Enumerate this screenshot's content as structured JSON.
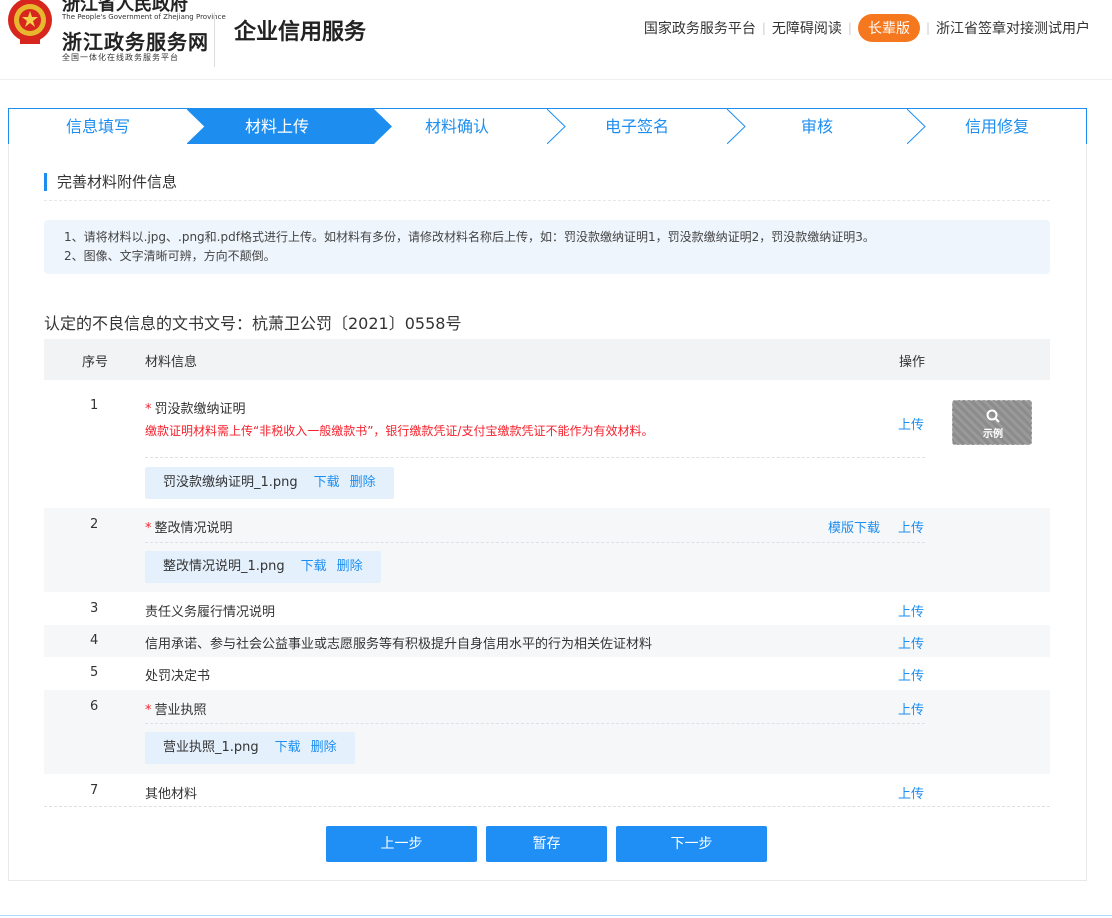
{
  "header": {
    "gov_name": "浙江省人民政府",
    "gov_name_en": "The People's Government of Zhejiang Province",
    "portal_name": "浙江政务服务网",
    "portal_sub": "全国一体化在线政务服务平台",
    "service_title": "企业信用服务",
    "links": {
      "national_platform": "国家政务服务平台",
      "accessibility": "无障碍阅读",
      "elder_mode": "长辈版",
      "user": "浙江省签章对接测试用户"
    }
  },
  "steps": [
    {
      "label": "信息填写",
      "active": false
    },
    {
      "label": "材料上传",
      "active": true
    },
    {
      "label": "材料确认",
      "active": false
    },
    {
      "label": "电子签名",
      "active": false
    },
    {
      "label": "审核",
      "active": false
    },
    {
      "label": "信用修复",
      "active": false
    }
  ],
  "section": {
    "title": "完善材料附件信息",
    "notice_1": "1、请将材料以.jpg、.png和.pdf格式进行上传。如材料有多份，请修改材料名称后上传，如：罚没款缴纳证明1，罚没款缴纳证明2，罚没款缴纳证明3。",
    "notice_2": "2、图像、文字清晰可辨，方向不颠倒。"
  },
  "doc_number": "认定的不良信息的文书文号：杭萧卫公罚〔2021〕0558号",
  "table": {
    "headers": {
      "no": "序号",
      "info": "材料信息",
      "op": "操作"
    },
    "rows": [
      {
        "no": "1",
        "name": "罚没款缴纳证明",
        "warning": "缴款证明材料需上传“非税收入一般缴款书”，银行缴款凭证/支付宝缴款凭证不能作为有效材料。",
        "upload": "上传",
        "example": "示例",
        "file": "罚没款缴纳证明_1.png",
        "download": "下载",
        "delete": "删除"
      },
      {
        "no": "2",
        "name": "整改情况说明",
        "template": "模版下载",
        "upload": "上传",
        "file": "整改情况说明_1.png",
        "download": "下载",
        "delete": "删除"
      },
      {
        "no": "3",
        "name": "责任义务履行情况说明",
        "upload": "上传"
      },
      {
        "no": "4",
        "name": "信用承诺、参与社会公益事业或志愿服务等有积极提升自身信用水平的行为相关佐证材料",
        "upload": "上传"
      },
      {
        "no": "5",
        "name": "处罚决定书",
        "upload": "上传"
      },
      {
        "no": "6",
        "name": "营业执照",
        "upload": "上传",
        "file": "营业执照_1.png",
        "download": "下载",
        "delete": "删除"
      },
      {
        "no": "7",
        "name": "其他材料",
        "upload": "上传"
      }
    ]
  },
  "buttons": {
    "prev": "上一步",
    "save": "暂存",
    "next": "下一步"
  },
  "colors": {
    "primary": "#1d8ef0",
    "required": "#f5222d",
    "elder_button": "#f5781e"
  }
}
